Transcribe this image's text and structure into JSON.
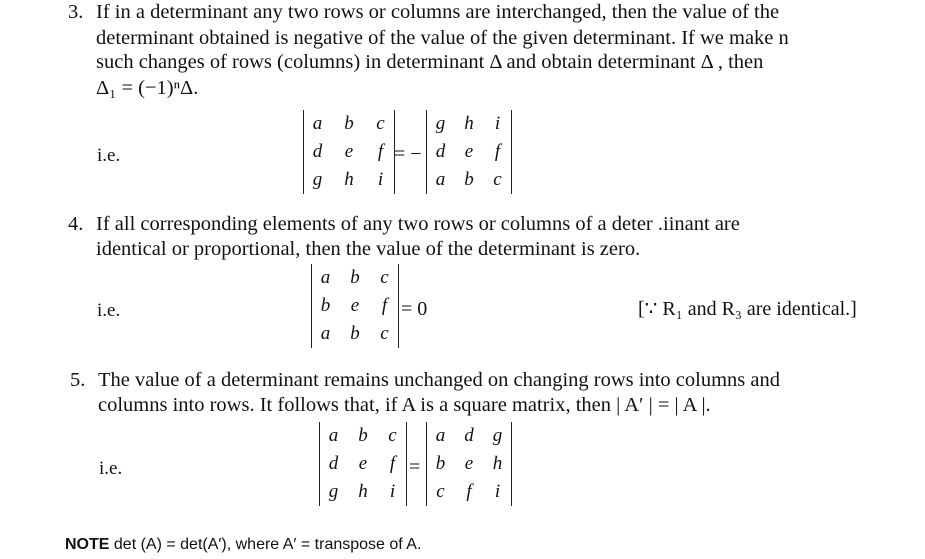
{
  "item3": {
    "number": "3.",
    "lines": [
      "If in a determinant any two rows or columns are interchanged, then the value of the",
      "determinant obtained is negative of the value of the given determinant. If we make n",
      "such changes of rows (columns) in determinant Δ and obtain determinant Δ , then",
      "Δ₁ = (−1)ⁿΔ."
    ],
    "ie": "i.e.",
    "left_det": [
      [
        "a",
        "b",
        "c"
      ],
      [
        "d",
        "e",
        "f"
      ],
      [
        "g",
        "h",
        "i"
      ]
    ],
    "op": "= −",
    "right_det": [
      [
        "g",
        "h",
        "i"
      ],
      [
        "d",
        "e",
        "f"
      ],
      [
        "a",
        "b",
        "c"
      ]
    ]
  },
  "item4": {
    "number": "4.",
    "lines": [
      "If all corresponding elements of any two rows or columns of a deter .iinant are",
      "identical or proportional, then the value of the determinant is zero."
    ],
    "ie": "i.e.",
    "det": [
      [
        "a",
        "b",
        "c"
      ],
      [
        "b",
        "e",
        "f"
      ],
      [
        "a",
        "b",
        "c"
      ]
    ],
    "op": "= 0",
    "reason": "[∵ R₁ and R₃ are identical.]"
  },
  "item5": {
    "number": "5.",
    "lines": [
      "The value of a determinant remains unchanged on changing rows into columns and",
      "columns into rows. It follows that, if A is a square matrix, then | A′ | = | A |."
    ],
    "ie": "i.e.",
    "left_det": [
      [
        "a",
        "b",
        "c"
      ],
      [
        "d",
        "e",
        "f"
      ],
      [
        "g",
        "h",
        "i"
      ]
    ],
    "op": "=",
    "right_det": [
      [
        "a",
        "d",
        "g"
      ],
      [
        "b",
        "e",
        "h"
      ],
      [
        "c",
        "f",
        "i"
      ]
    ]
  },
  "note": {
    "label": "NOTE",
    "text": "det (A) = det(A′), where A′ = transpose of A."
  }
}
